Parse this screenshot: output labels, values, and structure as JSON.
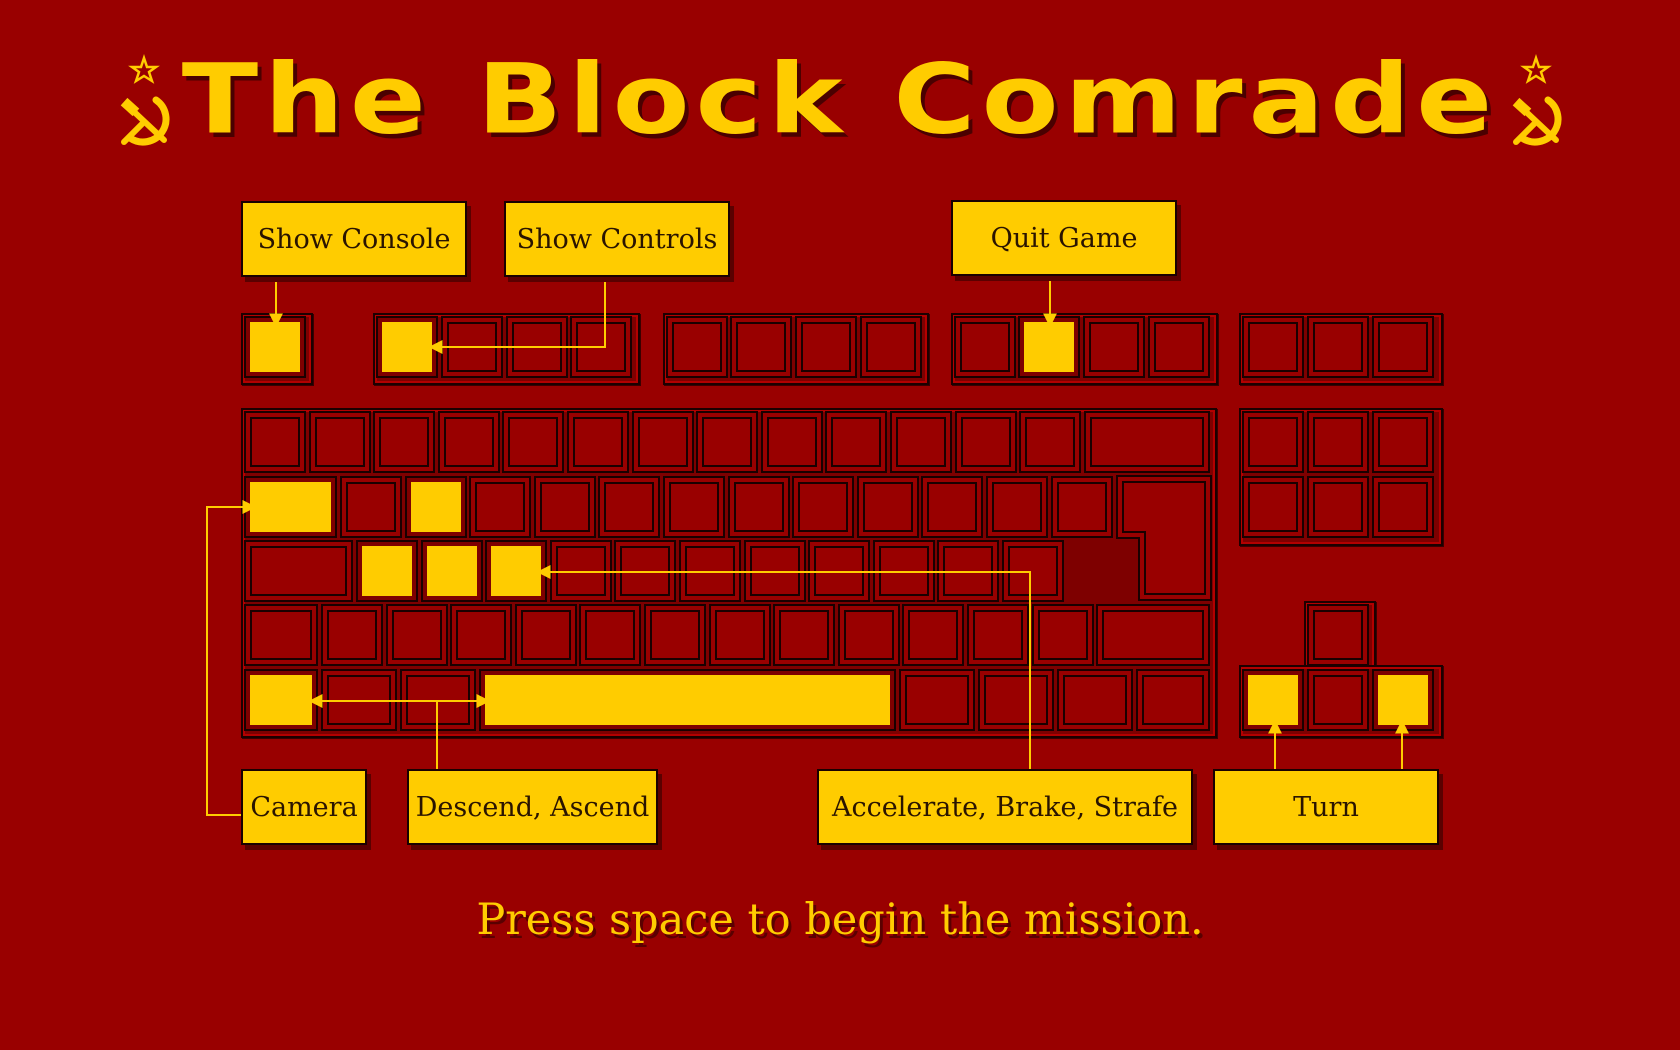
{
  "title": "The Block Comrade",
  "emblem_icon": "hammer-and-sickle",
  "colors": {
    "background": "#990000",
    "accent": "#ffcc00",
    "key_outline": "#1a0000"
  },
  "labels": {
    "show_console": "Show Console",
    "show_controls": "Show Controls",
    "quit_game": "Quit Game",
    "camera": "Camera",
    "descend_ascend": "Descend, Ascend",
    "accelerate_brake_strafe": "Accelerate, Brake, Strafe",
    "turn": "Turn"
  },
  "prompt": "Press space to begin the mission."
}
